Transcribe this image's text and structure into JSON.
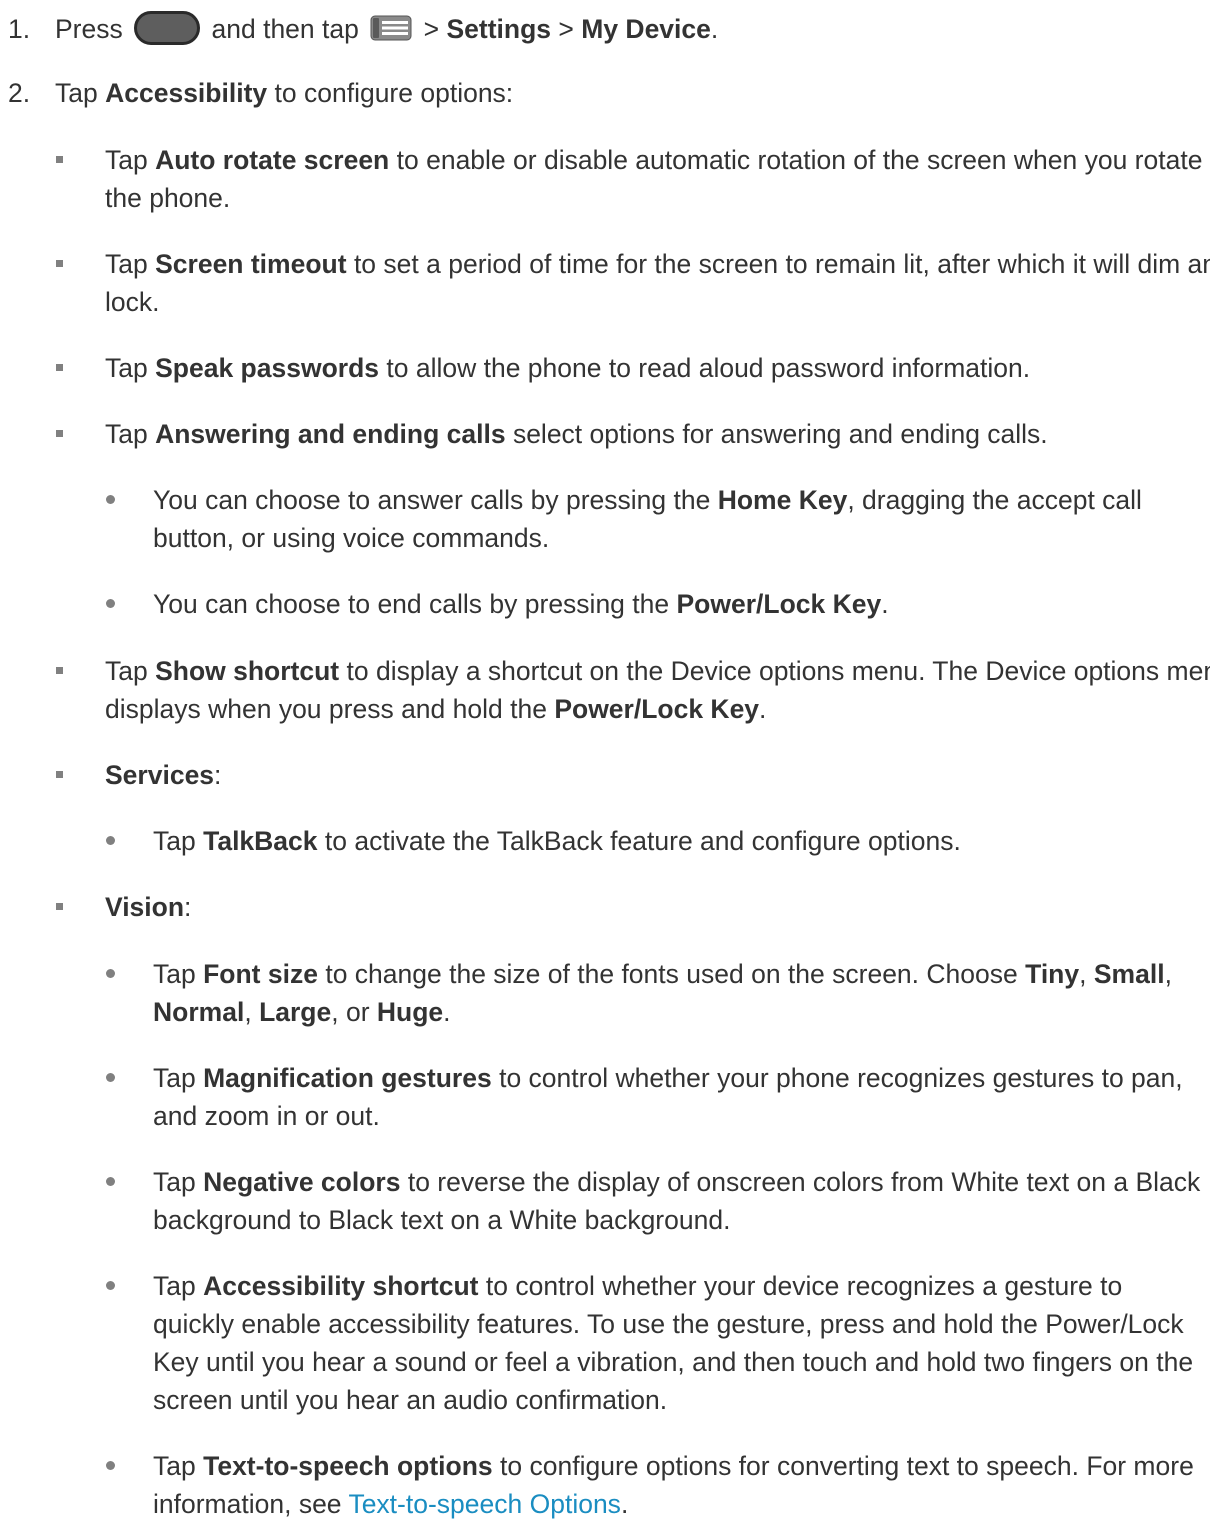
{
  "step1": {
    "number": "1.",
    "press": "Press",
    "and_then_tap": "and then tap",
    "sep1": ">",
    "settings": "Settings",
    "sep2": ">",
    "my_device": "My Device",
    "period": "."
  },
  "step2": {
    "number": "2.",
    "tap": "Tap",
    "accessibility": "Accessibility",
    "rest": "to configure options:"
  },
  "items": {
    "auto_rotate": {
      "tap": "Tap",
      "term": "Auto rotate screen",
      "rest": "to enable or disable automatic rotation of the screen when you rotate the phone."
    },
    "screen_timeout": {
      "tap": "Tap",
      "term": "Screen timeout",
      "rest": "to set a period of time for the screen to remain lit, after which it will dim and lock."
    },
    "speak_passwords": {
      "tap": "Tap",
      "term": "Speak passwords",
      "rest": "to allow the phone to read aloud password information."
    },
    "answering": {
      "tap": "Tap",
      "term": "Answering and ending calls",
      "rest": "select options for answering and ending calls."
    },
    "answer_calls": {
      "pre": "You can choose to answer calls by pressing the",
      "term": "Home Key",
      "rest": ", dragging the accept call button, or using voice commands."
    },
    "end_calls": {
      "pre": "You can choose to end calls by pressing the",
      "term": "Power/Lock Key",
      "rest": "."
    },
    "show_shortcut": {
      "tap": "Tap",
      "term": "Show shortcut",
      "rest": "to display a shortcut on the Device options menu. The Device options menu displays when you press and hold the",
      "term2": "Power/Lock Key",
      "end": "."
    },
    "services": {
      "term": "Services",
      "colon": ":"
    },
    "talkback": {
      "tap": "Tap",
      "term": "TalkBack",
      "rest": "to activate the TalkBack feature and configure options."
    },
    "vision": {
      "term": "Vision",
      "colon": ":"
    },
    "font_size": {
      "tap": "Tap",
      "term": "Font size",
      "rest": "to change the size of the fonts used on the screen. Choose",
      "opt1": "Tiny",
      "c1": ",",
      "opt2": "Small",
      "c2": ",",
      "opt3": "Normal",
      "c3": ",",
      "opt4": "Large",
      "c4": ", or",
      "opt5": "Huge",
      "end": "."
    },
    "magnification": {
      "tap": "Tap",
      "term": "Magnification gestures",
      "rest": "to control whether your phone recognizes gestures to pan, and zoom in or out."
    },
    "negative_colors": {
      "tap": "Tap",
      "term": "Negative colors",
      "rest": "to reverse the display of onscreen colors from White text on a Black background to Black text on a White background."
    },
    "accessibility_shortcut": {
      "tap": "Tap",
      "term": "Accessibility shortcut",
      "rest": "to control whether your device recognizes a gesture to quickly enable accessibility features. To use the gesture, press and hold the Power/Lock Key until you hear a sound or feel a vibration, and then touch and hold two fingers on the screen until you hear an audio confirmation."
    },
    "tts": {
      "tap": "Tap",
      "term": "Text-to-speech options",
      "rest": "to configure options for converting text to speech. For more information, see",
      "link": "Text-to-speech Options",
      "end": "."
    }
  },
  "icons": {
    "hardware_key": "home-key-icon",
    "menu": "menu-icon"
  },
  "colors": {
    "text": "#333333",
    "bullet": "#808080",
    "link": "#1a8dc1"
  }
}
